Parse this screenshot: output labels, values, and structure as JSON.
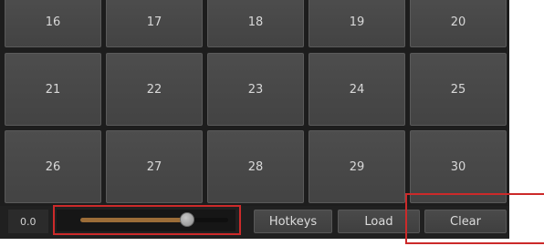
{
  "pads": [
    "16",
    "17",
    "18",
    "19",
    "20",
    "21",
    "22",
    "23",
    "24",
    "25",
    "26",
    "27",
    "28",
    "29",
    "30"
  ],
  "controls": {
    "value_display": "0.0",
    "slider_level": 0.72,
    "hotkeys_label": "Hotkeys",
    "load_label": "Load",
    "clear_label": "Clear"
  },
  "colors": {
    "background": "#1d1d1d",
    "pad": "#4a4a4a",
    "slider_fill": "#9c6d38",
    "highlight": "#cc2a2a"
  }
}
